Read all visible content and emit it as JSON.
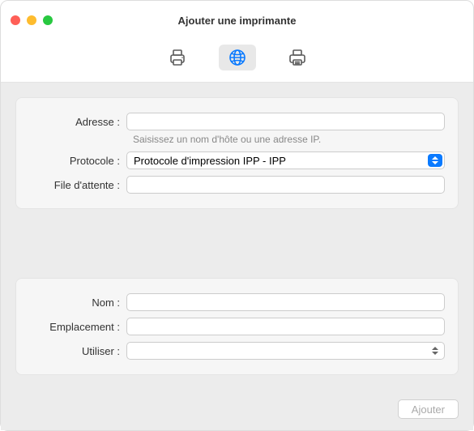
{
  "window": {
    "title": "Ajouter une imprimante"
  },
  "toolbar": {
    "items": [
      {
        "icon": "printer-default-icon",
        "selected": false
      },
      {
        "icon": "globe-icon",
        "selected": true
      },
      {
        "icon": "printer-advanced-icon",
        "selected": false
      }
    ]
  },
  "section1": {
    "address_label": "Adresse :",
    "address_value": "",
    "address_hint": "Saisissez un nom d'hôte ou une adresse IP.",
    "protocol_label": "Protocole :",
    "protocol_value": "Protocole d'impression IPP - IPP",
    "queue_label": "File d'attente :",
    "queue_value": ""
  },
  "section2": {
    "name_label": "Nom :",
    "name_value": "",
    "location_label": "Emplacement :",
    "location_value": "",
    "use_label": "Utiliser :",
    "use_value": ""
  },
  "footer": {
    "add_label": "Ajouter",
    "add_enabled": false
  }
}
